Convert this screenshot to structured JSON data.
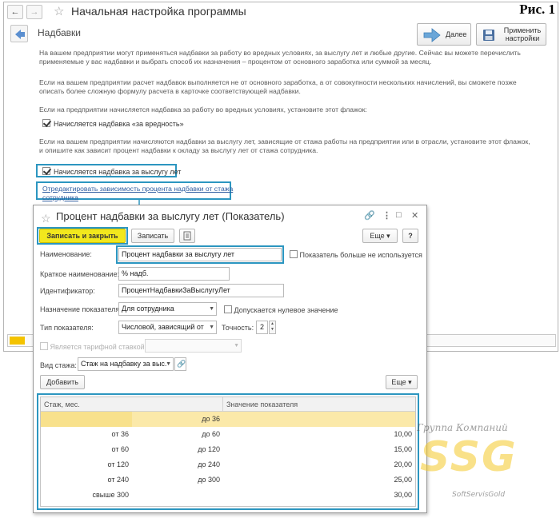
{
  "figure_label": "Рис. 1",
  "window": {
    "title": "Начальная настройка программы",
    "section_title": "Надбавки",
    "next_label": "Далее",
    "apply_label": "Применить настройки"
  },
  "intro": {
    "p1": "На вашем предприятии могут применяться надбавки за работу во вредных условиях, за выслугу лет и любые другие. Сейчас вы можете перечислить применяемые у вас надбавки и выбрать способ их назначения – процентом от основного заработка или суммой за месяц.",
    "p2": "Если на вашем предприятии расчет надбавок выполняется не от основного заработка, а от  совокупности нескольких начислений, вы сможете позже описать более сложную формулу расчета в карточке соответствующей надбавки.",
    "p3": "Если на предприятии начисляется надбавка за работу во вредных условиях, установите этот флажок:",
    "cb_harm": "Начисляется надбавка «за вредность»",
    "p4": "Если на вашем предприятии начисляются надбавки за выслугу лет, зависящие от стажа работы на предприятии или в отрасли, установите этот флажок, и опишите как зависит процент надбавки к окладу за выслугу лет от стажа сотрудника.",
    "cb_seniority": "Начисляется надбавка за выслугу лет",
    "link": "Отредактировать зависимость процента надбавки от стажа сотрудника"
  },
  "progress": {
    "value": 0.03,
    "color": "#f4c300"
  },
  "dialog": {
    "title": "Процент надбавки за выслугу лет (Показатель)",
    "save_close": "Записать и закрыть",
    "save": "Записать",
    "more": "Еще",
    "help": "?",
    "name_label": "Наименование:",
    "name_value": "Процент надбавки за выслугу лет",
    "unused_label": "Показатель больше не используется",
    "short_label": "Краткое наименование:",
    "short_value": "% надб.",
    "id_label": "Идентификатор:",
    "id_value": "ПроцентНадбавкиЗаВыслугуЛет",
    "purpose_label": "Назначение показателя:",
    "purpose_value": "Для сотрудника",
    "zero_label": "Допускается нулевое значение",
    "type_label": "Тип показателя:",
    "type_value": "Числовой, зависящий от",
    "precision_label": "Точность:",
    "precision_value": "2",
    "tariff_label": "Является тарифной ставкой",
    "stazh_label": "Вид стажа:",
    "stazh_value": "Стаж на надбавку за выс.",
    "add": "Добавить",
    "table": {
      "col1": "Стаж, мес.",
      "col2": "Значение показателя",
      "rows": [
        {
          "from": "",
          "to": "до 36",
          "value": ""
        },
        {
          "from": "от 36",
          "to": "до 60",
          "value": "10,00"
        },
        {
          "from": "от 60",
          "to": "до 120",
          "value": "15,00"
        },
        {
          "from": "от 120",
          "to": "до 240",
          "value": "20,00"
        },
        {
          "from": "от 240",
          "to": "до 300",
          "value": "25,00"
        },
        {
          "from": "свыше 300",
          "to": "",
          "value": "30,00"
        }
      ]
    }
  },
  "watermark": {
    "top": "Группа Компаний",
    "big": "SSG",
    "bottom": "SoftServisGold"
  },
  "colors": {
    "highlight": "#2c96c0",
    "primary_button": "#f2e81d",
    "selected_row": "#fbe9a9"
  }
}
